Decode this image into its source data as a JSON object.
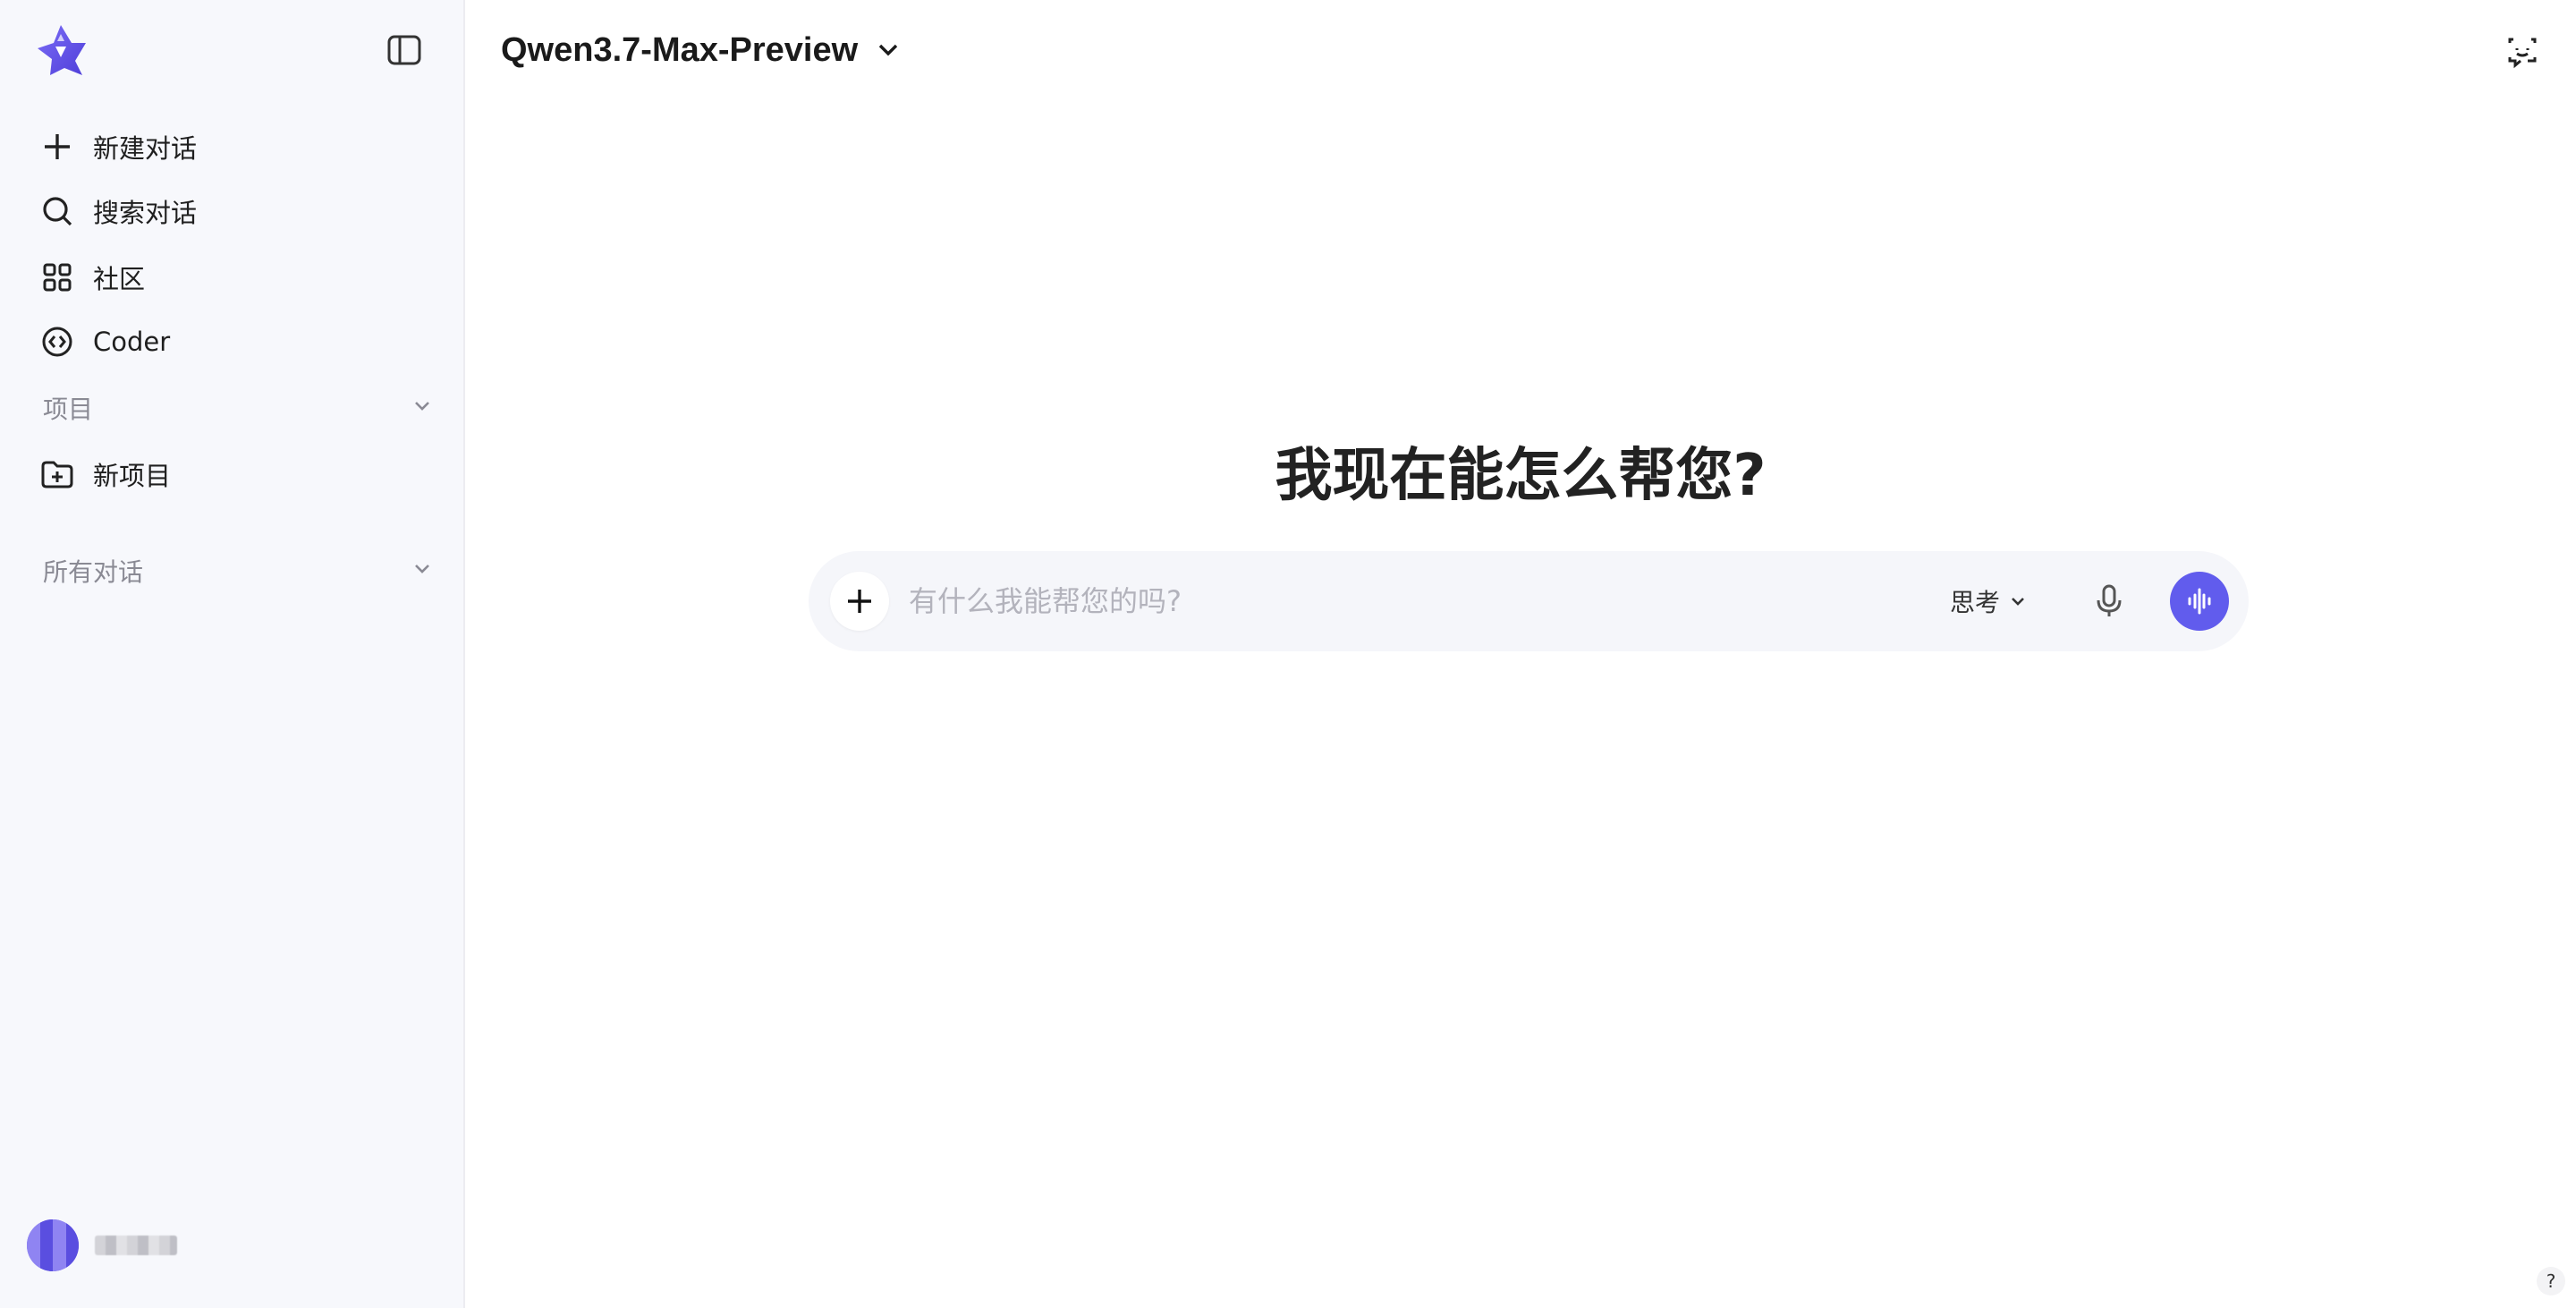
{
  "sidebar": {
    "items": [
      {
        "label": "新建对话",
        "icon": "plus-icon"
      },
      {
        "label": "搜索对话",
        "icon": "search-icon"
      },
      {
        "label": "社区",
        "icon": "grid-icon"
      },
      {
        "label": "Coder",
        "icon": "code-icon"
      }
    ],
    "projects_section": {
      "label": "项目"
    },
    "new_project": {
      "label": "新项目",
      "icon": "folder-plus-icon"
    },
    "all_chats_section": {
      "label": "所有对话"
    },
    "user": {
      "name": "■■■■"
    }
  },
  "header": {
    "model_name": "Qwen3.7-Max-Preview"
  },
  "main": {
    "greeting": "我现在能怎么帮您?",
    "composer": {
      "placeholder": "有什么我能帮您的吗?",
      "think_label": "思考"
    }
  },
  "help": {
    "label": "?"
  },
  "colors": {
    "accent": "#615ced",
    "sidebar_bg": "#f7f8fc",
    "composer_bg": "#f5f6fa"
  }
}
